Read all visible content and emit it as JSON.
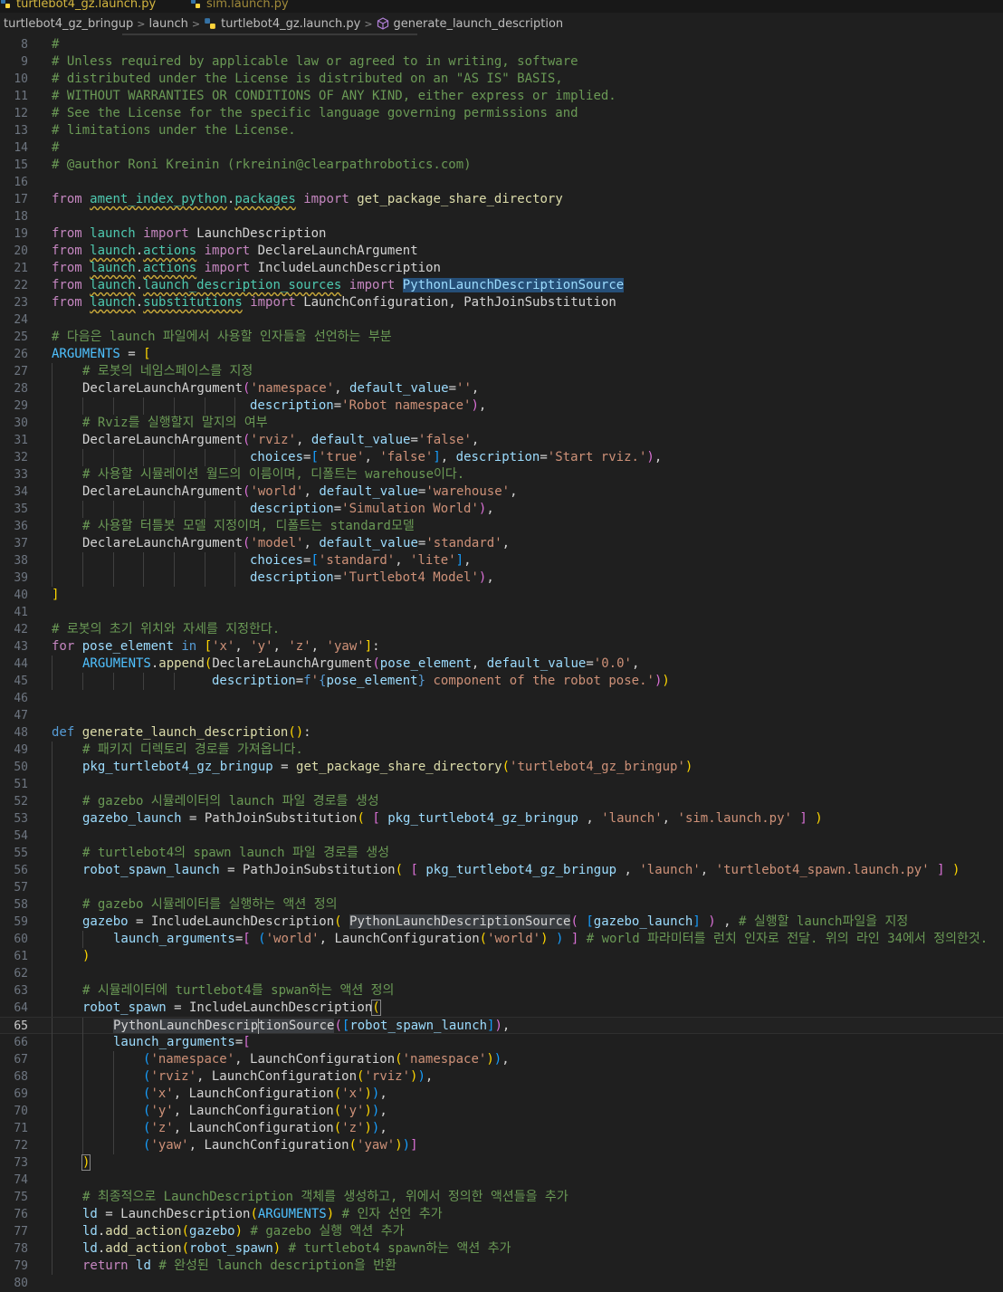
{
  "tabs": [
    {
      "label": "turtlebot4_gz.launch.py",
      "state": "active"
    },
    {
      "label": "sim.launch.py",
      "state": "inactive"
    }
  ],
  "breadcrumb": {
    "items": [
      "turtlebot4_gz_bringup",
      "launch",
      "turtlebot4_gz.launch.py",
      "generate_launch_description"
    ]
  },
  "editor": {
    "current_line": 65,
    "lines": [
      {
        "n": "8"
      },
      {
        "n": "9"
      },
      {
        "n": "10"
      },
      {
        "n": "11"
      },
      {
        "n": "12"
      },
      {
        "n": "13"
      },
      {
        "n": "14"
      },
      {
        "n": "15"
      },
      {
        "n": "16"
      },
      {
        "n": "17"
      },
      {
        "n": "18"
      },
      {
        "n": "19"
      },
      {
        "n": "20"
      },
      {
        "n": "21"
      },
      {
        "n": "22"
      },
      {
        "n": "23"
      },
      {
        "n": "24"
      },
      {
        "n": "25"
      },
      {
        "n": "26"
      },
      {
        "n": "27"
      },
      {
        "n": "28"
      },
      {
        "n": "29"
      },
      {
        "n": "30"
      },
      {
        "n": "31"
      },
      {
        "n": "32"
      },
      {
        "n": "33"
      },
      {
        "n": "34"
      },
      {
        "n": "35"
      },
      {
        "n": "36"
      },
      {
        "n": "37"
      },
      {
        "n": "38"
      },
      {
        "n": "39"
      },
      {
        "n": "40"
      },
      {
        "n": "41"
      },
      {
        "n": "42"
      },
      {
        "n": "43"
      },
      {
        "n": "44"
      },
      {
        "n": "45"
      },
      {
        "n": "46"
      },
      {
        "n": "47"
      },
      {
        "n": "48"
      },
      {
        "n": "49"
      },
      {
        "n": "50"
      },
      {
        "n": "51"
      },
      {
        "n": "52"
      },
      {
        "n": "53"
      },
      {
        "n": "54"
      },
      {
        "n": "55"
      },
      {
        "n": "56"
      },
      {
        "n": "57"
      },
      {
        "n": "58"
      },
      {
        "n": "59"
      },
      {
        "n": "60"
      },
      {
        "n": "61"
      },
      {
        "n": "62"
      },
      {
        "n": "63"
      },
      {
        "n": "64"
      },
      {
        "n": "65"
      },
      {
        "n": "66"
      },
      {
        "n": "67"
      },
      {
        "n": "68"
      },
      {
        "n": "69"
      },
      {
        "n": "70"
      },
      {
        "n": "71"
      },
      {
        "n": "72"
      },
      {
        "n": "73"
      },
      {
        "n": "74"
      },
      {
        "n": "75"
      },
      {
        "n": "76"
      },
      {
        "n": "77"
      },
      {
        "n": "78"
      },
      {
        "n": "79"
      },
      {
        "n": "80"
      }
    ],
    "code": {
      "l8": "#",
      "l9": "# Unless required by applicable law or agreed to in writing, software",
      "l10": "# distributed under the License is distributed on an \"AS IS\" BASIS,",
      "l11": "# WITHOUT WARRANTIES OR CONDITIONS OF ANY KIND, either express or implied.",
      "l12": "# See the License for the specific language governing permissions and",
      "l13": "# limitations under the License.",
      "l14": "#",
      "l15": "# @author Roni Kreinin (rkreinin@clearpathrobotics.com)",
      "l25": "# 다음은 launch 파일에서 사용할 인자들을 선언하는 부분",
      "l27": "# 로봇의 네임스페이스를 지정",
      "l30": "# Rviz를 실행할지 말지의 여부",
      "l33": "# 사용할 시뮬레이션 월드의 이름이며, 디폴트는 warehouse이다.",
      "l36": "# 사용할 터틀봇 모델 지정이며, 디폴트는 standard모델",
      "l42": "# 로봇의 초기 위치와 자세를 지정한다.",
      "l49": "# 패키지 디렉토리 경로를 가져옵니다.",
      "l52": "# gazebo 시뮬레이터의 launch 파일 경로를 생성",
      "l55": "# turtlebot4의 spawn launch 파일 경로를 생성",
      "l58": "# gazebo 시뮬레이터를 실행하는 액션 정의",
      "l59c": "# 실행할 launch파일을 지정",
      "l60c": "# world 파라미터를 런치 인자로 전달. 위의 라인 34에서 정의한것.",
      "l63": "# 시뮬레이터에 turtlebot4를 spwan하는 액션 정의",
      "l75": "# 최종적으로 LaunchDescription 객체를 생성하고, 위에서 정의한 액션들을 추가",
      "l76c": "# 인자 선언 추가",
      "l77c": "# gazebo 실행 액션 추가",
      "l78c": "# turtlebot4 spawn하는 액션 추가",
      "l79c": "# 완성된 launch description을 반환"
    }
  },
  "colors": {
    "background": "#1f1f1f",
    "comment": "#6a9955",
    "keyword": "#569cd6",
    "import_keyword": "#c586c0",
    "string": "#ce9178",
    "function": "#dcdcaa",
    "variable": "#9cdcfe",
    "class": "#4ec9b0",
    "selection": "#264f78"
  }
}
